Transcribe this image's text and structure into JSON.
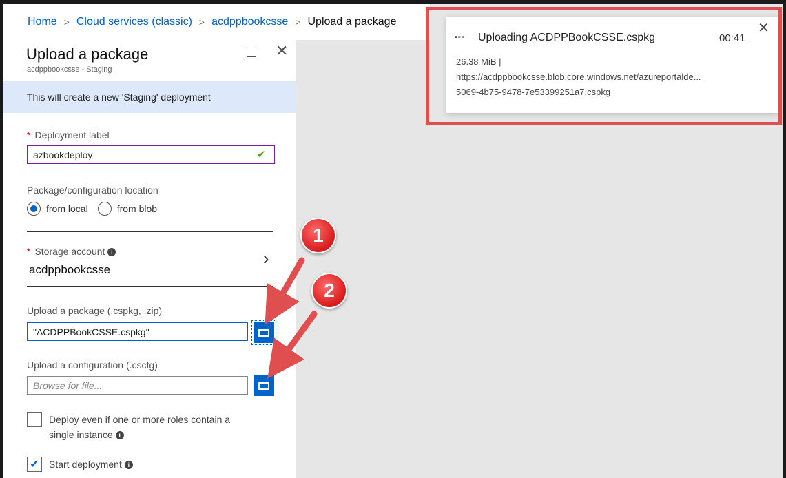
{
  "breadcrumb": {
    "items": [
      "Home",
      "Cloud services (classic)",
      "acdppbookcsse"
    ],
    "current": "Upload a package"
  },
  "blade": {
    "title": "Upload a package",
    "subtitle": "acdppbookcsse - Staging",
    "info": "This will create a new 'Staging' deployment",
    "deployment_label": {
      "label": "Deployment label",
      "value": "azbookdeploy"
    },
    "location": {
      "label": "Package/configuration location",
      "options": [
        "from local",
        "from blob"
      ],
      "selected": "from local"
    },
    "storage_account": {
      "label": "Storage account",
      "value": "acdppbookcsse"
    },
    "package": {
      "label": "Upload a package (.cspkg, .zip)",
      "value": "\"ACDPPBookCSSE.cspkg\""
    },
    "configuration": {
      "label": "Upload a configuration (.cscfg)",
      "placeholder": "Browse for file..."
    },
    "deploy_single": {
      "label_line1": "Deploy even if one or more roles contain a",
      "label_line2": "single instance",
      "checked": false
    },
    "start_deployment": {
      "label": "Start deployment",
      "checked": true
    }
  },
  "notification": {
    "title": "Uploading ACDPPBookCSSE.cspkg",
    "time": "00:41",
    "size": "26.38 MiB |",
    "url_line1": "https://acdppbookcsse.blob.core.windows.net/azureportalde...",
    "url_line2": "5069-4b75-9478-7e53399251a7.cspkg"
  },
  "annotations": {
    "badge_1": "1",
    "badge_2": "2",
    "color": "#e04f4f"
  },
  "colors": {
    "accent": "#0063c8",
    "info_bg": "#dde9fb",
    "panel_bg": "#e6e6e6",
    "required": "#d0021b",
    "valid": "#57a300"
  }
}
